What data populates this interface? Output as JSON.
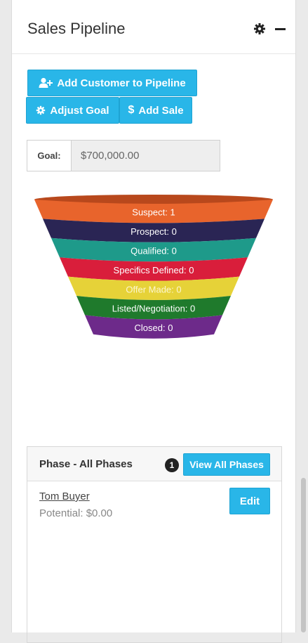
{
  "header": {
    "title": "Sales Pipeline"
  },
  "buttons": {
    "add_customer": "Add Customer to Pipeline",
    "adjust_goal": "Adjust Goal",
    "add_sale": "Add Sale"
  },
  "goal": {
    "label": "Goal:",
    "value": "$700,000.00"
  },
  "chart_data": {
    "type": "funnel",
    "stages": [
      {
        "label": "Suspect: 1",
        "color": "#e8642c"
      },
      {
        "label": "Prospect: 0",
        "color": "#2a2554"
      },
      {
        "label": "Qualified: 0",
        "color": "#1e9a8a"
      },
      {
        "label": "Specifics Defined: 0",
        "color": "#d91e3b"
      },
      {
        "label": "Offer Made: 0",
        "color": "#e6d238"
      },
      {
        "label": "Listed/Negotiation: 0",
        "color": "#1f7a2c"
      },
      {
        "label": "Closed: 0",
        "color": "#6d2a8a"
      }
    ]
  },
  "phase": {
    "title": "Phase - All Phases",
    "badge": "1",
    "view_all": "View All Phases",
    "customers": [
      {
        "name": "Tom Buyer",
        "potential": "Potential: $0.00",
        "edit": "Edit"
      }
    ]
  },
  "colors": {
    "accent": "#29b6e8"
  }
}
